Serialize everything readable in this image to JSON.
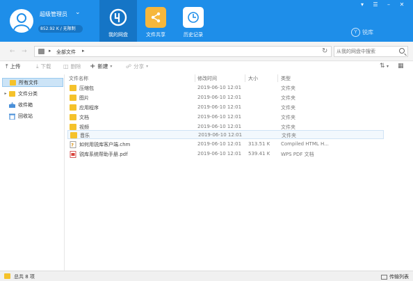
{
  "user": {
    "name": "超级管理员",
    "quota": "852.92 K / 无限制"
  },
  "nav_tabs": [
    {
      "label": "我的网盘",
      "icon": "cloud-drive-icon",
      "active": true
    },
    {
      "label": "文件共享",
      "icon": "share-folder-icon",
      "active": false
    },
    {
      "label": "历史记录",
      "icon": "history-icon",
      "active": false
    }
  ],
  "brand": {
    "name": "锐库"
  },
  "colors": {
    "topbar": "#1e8ee9",
    "active_tab": "#1575c6",
    "folder": "#f5c22b",
    "selection": "#cce4f7"
  },
  "breadcrumb": {
    "root": "全部文件"
  },
  "search": {
    "placeholder": "从我的网盘中搜索"
  },
  "toolbar": {
    "upload": "上传",
    "download": "下载",
    "delete": "删除",
    "new": "新建",
    "share": "分享"
  },
  "sidebar": {
    "items": [
      {
        "label": "所有文件",
        "icon": "folder-icon",
        "selected": true
      },
      {
        "label": "文件分类",
        "icon": "folder-icon",
        "selected": false,
        "expandable": true
      },
      {
        "label": "收件箱",
        "icon": "inbox-icon",
        "selected": false
      },
      {
        "label": "回收站",
        "icon": "recycle-bin-icon",
        "selected": false
      }
    ]
  },
  "columns": {
    "name": "文件名称",
    "modified": "修改时间",
    "size": "大小",
    "type": "类型"
  },
  "files": [
    {
      "name": "压缩包",
      "modified": "2019-06-10 12:01",
      "size": "",
      "type": "文件夹",
      "icon": "folder-icon"
    },
    {
      "name": "图片",
      "modified": "2019-06-10 12:01",
      "size": "",
      "type": "文件夹",
      "icon": "folder-icon"
    },
    {
      "name": "应用程序",
      "modified": "2019-06-10 12:01",
      "size": "",
      "type": "文件夹",
      "icon": "folder-icon"
    },
    {
      "name": "文档",
      "modified": "2019-06-10 12:01",
      "size": "",
      "type": "文件夹",
      "icon": "folder-icon"
    },
    {
      "name": "视频",
      "modified": "2019-06-10 12:01",
      "size": "",
      "type": "文件夹",
      "icon": "folder-icon"
    },
    {
      "name": "音乐",
      "modified": "2019-06-10 12:01",
      "size": "",
      "type": "文件夹",
      "icon": "folder-icon",
      "selected": true
    },
    {
      "name": "如何用锐库客户端.chm",
      "modified": "2019-06-10 12:01",
      "size": "313.51 K",
      "type": "Compiled HTML H...",
      "icon": "chm-file-icon"
    },
    {
      "name": "锐库系统帮助手册.pdf",
      "modified": "2019-06-10 12:01",
      "size": "539.41 K",
      "type": "WPS PDF 文档",
      "icon": "pdf-file-icon"
    }
  ],
  "status": {
    "count_text": "总共 8 项",
    "transfer_label": "传输列表"
  }
}
